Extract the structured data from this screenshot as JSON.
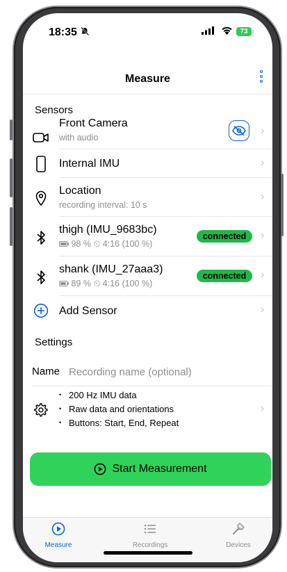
{
  "status_bar": {
    "time": "18:35",
    "battery": "73"
  },
  "nav": {
    "title": "Measure"
  },
  "sensors_section": {
    "header": "Sensors",
    "items": [
      {
        "name": "Front Camera",
        "detail": "with audio"
      },
      {
        "name": "Internal IMU"
      },
      {
        "name": "Location",
        "detail": "recording interval: 10 s"
      },
      {
        "name": "thigh (IMU_9683bc)",
        "detail": "98 % ⏲ 4:16 (100 %)",
        "status": "connected"
      },
      {
        "name": "shank (IMU_27aaa3)",
        "detail": "89 % ⏲ 4:16 (100 %)",
        "status": "connected"
      }
    ],
    "add_label": "Add Sensor"
  },
  "settings_section": {
    "header": "Settings",
    "name_label": "Name",
    "name_placeholder": "Recording name (optional)",
    "name_value": "",
    "config_lines": [
      "200 Hz IMU data",
      "Raw data and orientations",
      "Buttons: Start, End, Repeat"
    ]
  },
  "start_button": {
    "label": "Start Measurement"
  },
  "tabs": [
    {
      "label": "Measure",
      "active": true
    },
    {
      "label": "Recordings",
      "active": false
    },
    {
      "label": "Devices",
      "active": false
    }
  ],
  "colors": {
    "accent": "#0a63d6",
    "connected": "#1fb84b",
    "start": "#2fd35a",
    "secondary_text": "#8e8e93"
  }
}
